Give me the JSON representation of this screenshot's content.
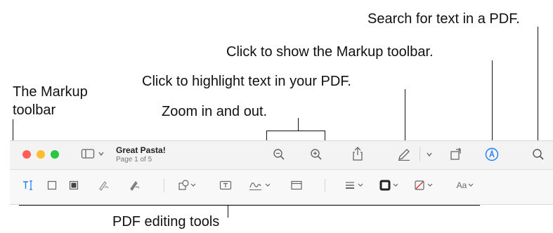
{
  "callouts": {
    "search": "Search for text in a PDF.",
    "markup_show": "Click to show the Markup toolbar.",
    "highlight": "Click to highlight text in your PDF.",
    "markup_toolbar_line1": "The Markup",
    "markup_toolbar_line2": "toolbar",
    "zoom": "Zoom in and out.",
    "editing_tools": "PDF editing tools"
  },
  "window": {
    "traffic_lights": {
      "close": "#ff5f57",
      "minimize": "#febc2e",
      "zoom": "#28c840"
    },
    "document_title": "Great Pasta!",
    "page_info": "Page 1 of 5"
  },
  "toolbar_icons": [
    "sidebar-icon",
    "chevron-down-icon",
    "zoom-out-icon",
    "zoom-in-icon",
    "share-icon",
    "highlight-pen-icon",
    "chevron-down-icon",
    "rotate-icon",
    "markup-icon",
    "search-icon"
  ],
  "markup_icons": [
    "text-selection-icon",
    "rectangle-selection-icon",
    "redact-icon",
    "sketch-icon",
    "draw-icon",
    "shapes-icon",
    "text-box-icon",
    "signature-icon",
    "note-icon",
    "shape-style-icon",
    "border-color-icon",
    "fill-color-icon",
    "text-style-icon"
  ],
  "markup_labels": {
    "text_style": "Aa"
  },
  "colors": {
    "accent": "#1e7cf2",
    "icon": "#666666"
  }
}
